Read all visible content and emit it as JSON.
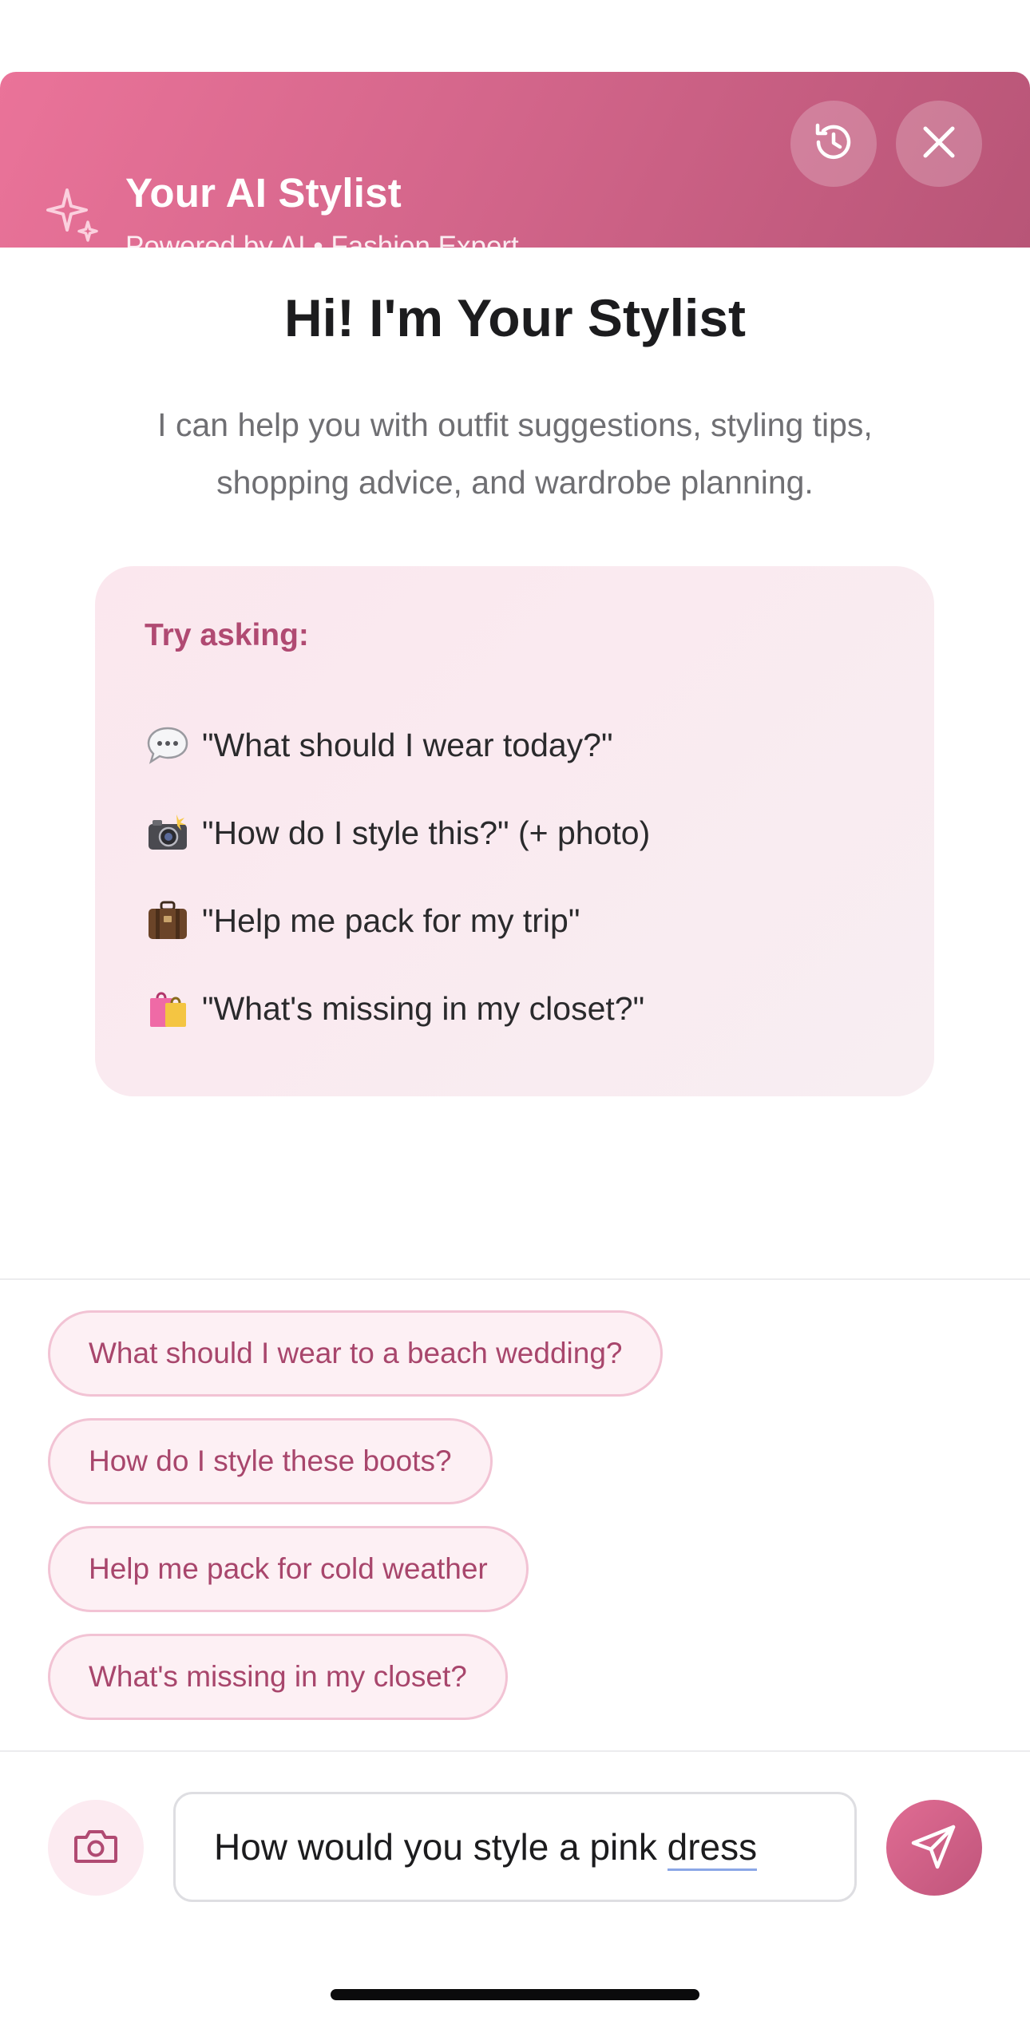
{
  "header": {
    "title": "Your AI Stylist",
    "subtitle": "Powered by AI • Fashion Expert",
    "icons": [
      "sparkles-icon",
      "history-icon",
      "close-icon"
    ]
  },
  "hero": {
    "title": "Hi! I'm Your Stylist",
    "description": "I can help you with outfit suggestions, styling tips, shopping advice, and wardrobe planning."
  },
  "try_asking": {
    "title": "Try asking:",
    "items": [
      {
        "icon": "speech-bubble-icon",
        "text": "\"What should I wear today?\""
      },
      {
        "icon": "camera-flash-icon",
        "text": "\"How do I style this?\" (+ photo)"
      },
      {
        "icon": "suitcase-icon",
        "text": "\"Help me pack for my trip\""
      },
      {
        "icon": "shopping-bags-icon",
        "text": "\"What's missing in my closet?\""
      }
    ]
  },
  "suggestions": [
    "What should I wear to a beach wedding?",
    "How do I style these boots?",
    "Help me pack for cold weather",
    "What's missing in my closet?"
  ],
  "composer": {
    "input_value_start": "How would you style a pink ",
    "input_value_misspelled": "dress",
    "icons": [
      "camera-icon",
      "send-icon"
    ]
  },
  "colors": {
    "header_gradient": [
      "#ea7399",
      "#b85577"
    ],
    "accent_text": "#a8466c",
    "chip_bg": "#fdf0f4",
    "card_bg": "#fbe7ee"
  }
}
